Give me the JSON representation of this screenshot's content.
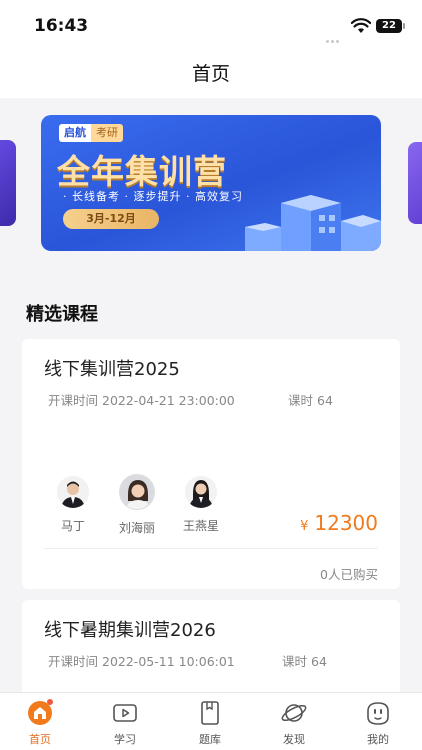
{
  "status_bar": {
    "time": "16:43",
    "battery": "22"
  },
  "nav": {
    "title": "首页"
  },
  "banner": {
    "brand_a": "启航",
    "brand_b": "考研",
    "title": "全年集训营",
    "subtitle": "· 长线备考 · 逐步提升 · 高效复习",
    "date_range": "3月-12月"
  },
  "section": {
    "title": "精选课程"
  },
  "courses": [
    {
      "title": "线下集训营2025",
      "start_label": "开课时间",
      "start_time": "2022-04-21 23:00:00",
      "hours_label": "课时",
      "hours": "64",
      "teachers": [
        {
          "name": "马丁"
        },
        {
          "name": "刘海丽"
        },
        {
          "name": "王燕星"
        }
      ],
      "currency": "¥",
      "price": "12300",
      "buyers": "0人已购买"
    },
    {
      "title": "线下暑期集训营2026",
      "start_label": "开课时间",
      "start_time": "2022-05-11 10:06:01",
      "hours_label": "课时",
      "hours": "64"
    }
  ],
  "tabs": [
    {
      "label": "首页",
      "icon": "home-icon",
      "active": true
    },
    {
      "label": "学习",
      "icon": "play-icon",
      "active": false
    },
    {
      "label": "题库",
      "icon": "book-icon",
      "active": false
    },
    {
      "label": "发现",
      "icon": "planet-icon",
      "active": false
    },
    {
      "label": "我的",
      "icon": "face-icon",
      "active": false
    }
  ],
  "colors": {
    "accent": "#f07a1c",
    "banner_blue": "#2a55d8",
    "active_tab": "#e56b21"
  }
}
